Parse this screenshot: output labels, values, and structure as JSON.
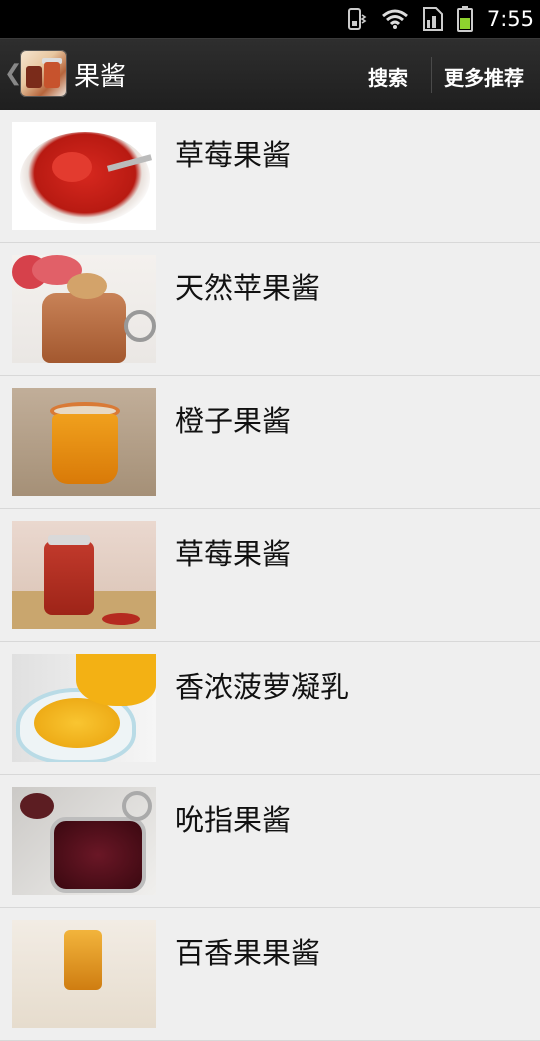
{
  "status": {
    "time": "7:55"
  },
  "header": {
    "title": "果酱",
    "search_label": "搜索",
    "more_label": "更多推荐"
  },
  "items": [
    {
      "label": "草莓果酱"
    },
    {
      "label": "天然苹果酱"
    },
    {
      "label": "橙子果酱"
    },
    {
      "label": "草莓果酱"
    },
    {
      "label": "香浓菠萝凝乳"
    },
    {
      "label": "吮指果酱"
    },
    {
      "label": "百香果果酱"
    }
  ]
}
